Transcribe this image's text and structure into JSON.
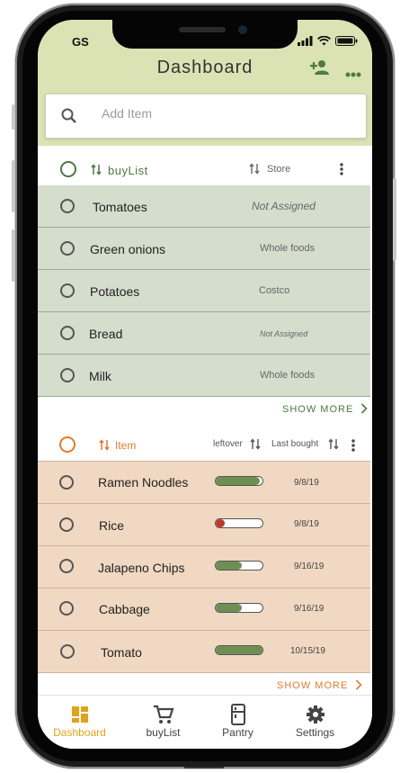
{
  "status_bar": {
    "initials": "GS"
  },
  "header": {
    "title": "Dashboard",
    "add_user_icon": "person-add-icon",
    "more_icon": "more-horizontal-icon"
  },
  "search": {
    "placeholder": "Add Item"
  },
  "buylist": {
    "title": "buyList",
    "sort_label": "Store",
    "items": [
      {
        "name": "Tomatoes",
        "store": "Not Assigned"
      },
      {
        "name": "Green onions",
        "store": "Whole foods"
      },
      {
        "name": "Potatoes",
        "store": "Costco"
      },
      {
        "name": "Bread",
        "store": "Not Assigned"
      },
      {
        "name": "Milk",
        "store": "Whole foods"
      }
    ],
    "show_more": "SHOW MORE"
  },
  "pantry": {
    "title": "Item",
    "leftover_label": "leftover",
    "last_bought_label": "Last bought",
    "items": [
      {
        "name": "Ramen Noodles",
        "leftover": 0.95,
        "date": "9/8/19",
        "color": "#6f8f52"
      },
      {
        "name": "Rice",
        "leftover": 0.2,
        "date": "9/8/19",
        "color": "#c0392b"
      },
      {
        "name": "Jalapeno Chips",
        "leftover": 0.55,
        "date": "9/16/19",
        "color": "#6f8f52"
      },
      {
        "name": "Cabbage",
        "leftover": 0.55,
        "date": "9/16/19",
        "color": "#6f8f52"
      },
      {
        "name": "Tomato",
        "leftover": 1.0,
        "date": "10/15/19",
        "color": "#6f8f52"
      }
    ],
    "show_more": "SHOW MORE"
  },
  "tabs": [
    {
      "label": "Dashboard",
      "icon": "dashboard-icon",
      "active": true
    },
    {
      "label": "buyList",
      "icon": "cart-icon",
      "active": false
    },
    {
      "label": "Pantry",
      "icon": "fridge-icon",
      "active": false
    },
    {
      "label": "Settings",
      "icon": "gear-icon",
      "active": false
    }
  ],
  "colors": {
    "header_bg": "#dbe3b4",
    "buylist_accent": "#4d7a43",
    "pantry_accent": "#e07a2e",
    "active_tab": "#e0a31a"
  }
}
